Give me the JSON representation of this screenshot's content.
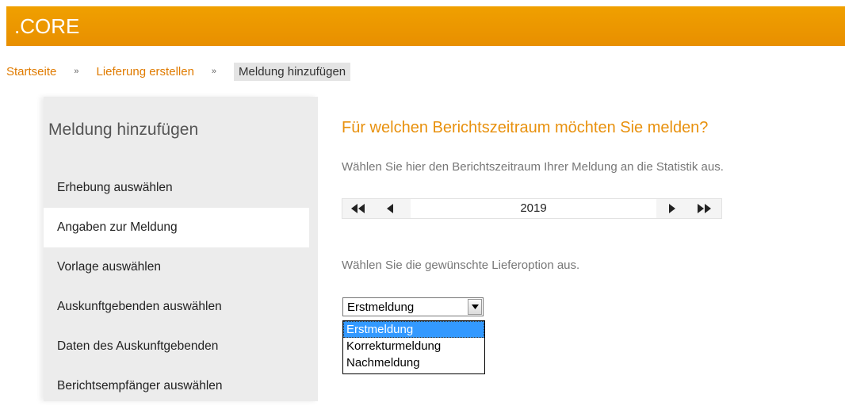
{
  "header": {
    "logo": ".CORE",
    "brand_color": "#f0a000"
  },
  "breadcrumb": {
    "items": [
      "Startseite",
      "Lieferung erstellen"
    ],
    "current": "Meldung hinzufügen",
    "separator": "»"
  },
  "sidebar": {
    "title": "Meldung hinzufügen",
    "items": [
      "Erhebung auswählen",
      "Angaben zur Meldung",
      "Vorlage auswählen",
      "Auskunftgebenden auswählen",
      "Daten des Auskunftgebenden",
      "Berichtsempfänger auswählen"
    ],
    "active_index": 1
  },
  "main": {
    "question": "Für welchen Berichtszeitraum möchten Sie melden?",
    "hint_period": "Wählen Sie hier den Berichtszeitraum Ihrer Meldung an die Statistik aus.",
    "year": "2019",
    "hint_option": "Wählen Sie die gewünschte Lieferoption aus.",
    "select": {
      "value": "Erstmeldung",
      "options": [
        "Erstmeldung",
        "Korrekturmeldung",
        "Nachmeldung"
      ],
      "highlighted": "Erstmeldung"
    }
  }
}
